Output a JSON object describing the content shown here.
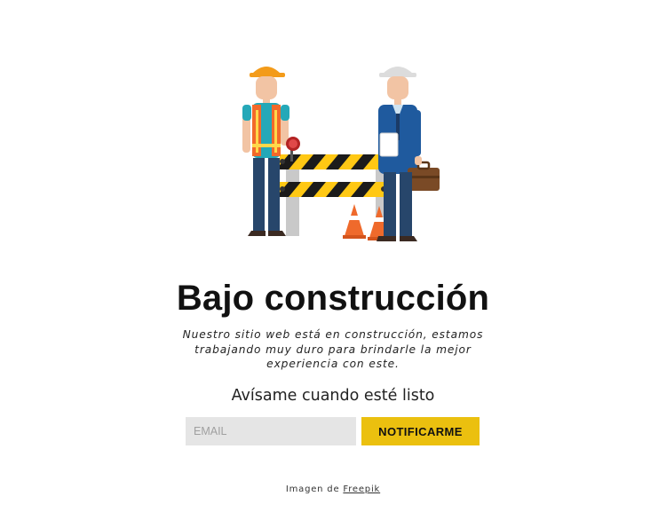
{
  "hero": {
    "illustration": "construction-workers-barrier-illustration"
  },
  "content": {
    "title": "Bajo construcción",
    "description": "Nuestro sitio web está en construcción, estamos trabajando muy duro para brindarle la mejor experiencia con este.",
    "notify_text": "Avísame cuando esté listo"
  },
  "form": {
    "email_placeholder": "EMAIL",
    "email_value": "",
    "submit_label": "NOTIFICARME"
  },
  "credit": {
    "prefix": "Imagen de",
    "link_text": "Freepik"
  },
  "colors": {
    "button": "#ebc00f",
    "input_bg": "#e5e5e5",
    "title": "#111111"
  }
}
